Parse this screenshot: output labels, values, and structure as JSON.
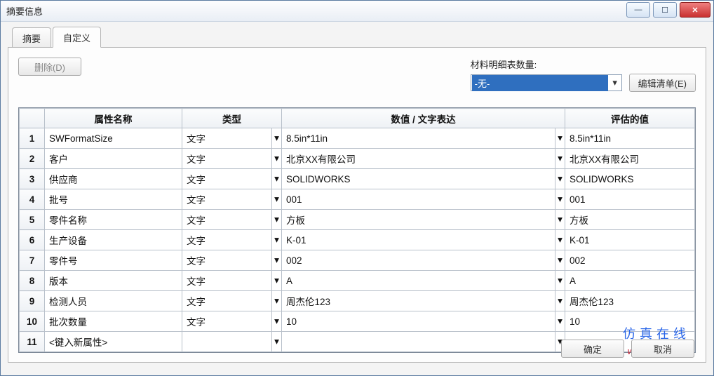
{
  "window": {
    "title": "摘要信息"
  },
  "tabs": {
    "summary": "摘要",
    "custom": "自定义"
  },
  "toolbar": {
    "delete_label": "删除(D)",
    "bom_label": "材料明细表数量:",
    "bom_selected": "-无-",
    "edit_list_label": "编辑清单(E)"
  },
  "grid": {
    "headers": {
      "name": "属性名称",
      "type": "类型",
      "value": "数值 / 文字表达",
      "eval": "评估的值"
    },
    "new_row_placeholder": "<键入新属性>",
    "type_text": "文字",
    "rows": [
      {
        "n": "1",
        "name": "SWFormatSize",
        "type": "文字",
        "value": "8.5in*11in",
        "eval": "8.5in*11in"
      },
      {
        "n": "2",
        "name": "客户",
        "type": "文字",
        "value": "北京XX有限公司",
        "eval": "北京XX有限公司"
      },
      {
        "n": "3",
        "name": "供应商",
        "type": "文字",
        "value": "SOLIDWORKS",
        "eval": "SOLIDWORKS"
      },
      {
        "n": "4",
        "name": "批号",
        "type": "文字",
        "value": "001",
        "eval": "001"
      },
      {
        "n": "5",
        "name": "零件名称",
        "type": "文字",
        "value": "方板",
        "eval": "方板"
      },
      {
        "n": "6",
        "name": "生产设备",
        "type": "文字",
        "value": "K-01",
        "eval": "K-01"
      },
      {
        "n": "7",
        "name": "零件号",
        "type": "文字",
        "value": "002",
        "eval": "002"
      },
      {
        "n": "8",
        "name": "版本",
        "type": "文字",
        "value": "A",
        "eval": "A"
      },
      {
        "n": "9",
        "name": "检测人员",
        "type": "文字",
        "value": "周杰伦123",
        "eval": "周杰伦123"
      },
      {
        "n": "10",
        "name": "批次数量",
        "type": "文字",
        "value": "10",
        "eval": "10"
      }
    ]
  },
  "buttons": {
    "ok": "确定",
    "cancel": "取消"
  },
  "watermark": {
    "line1": "仿真在线",
    "line2": "www.1CAE.com"
  }
}
